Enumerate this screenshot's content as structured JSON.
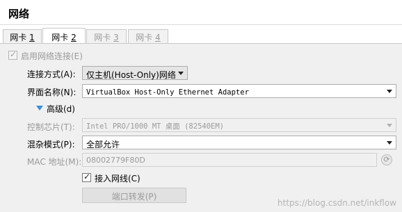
{
  "header": {
    "title": "网络"
  },
  "tabs": [
    {
      "label": "网卡 ",
      "key": "1",
      "state": "normal"
    },
    {
      "label": "网卡 ",
      "key": "2",
      "state": "active"
    },
    {
      "label": "网卡 ",
      "key": "3",
      "state": "disabled"
    },
    {
      "label": "网卡 ",
      "key": "4",
      "state": "disabled"
    }
  ],
  "enable_adapter": {
    "label": "启用网络连接(E)",
    "checked": true,
    "disabled": true
  },
  "attached_to": {
    "label": "连接方式(A):",
    "value": "仅主机(Host-Only)网络"
  },
  "adapter_name": {
    "label": "界面名称(N):",
    "value": "VirtualBox Host-Only Ethernet Adapter"
  },
  "advanced": {
    "label": "高级(d)",
    "expanded_icon": "triangle-down-icon"
  },
  "adapter_type": {
    "label": "控制芯片(T):",
    "value": "Intel PRO/1000 MT 桌面 (82540EM)"
  },
  "promiscuous": {
    "label": "混杂模式(P):",
    "value": "全部允许"
  },
  "mac": {
    "label": "MAC 地址(M):",
    "value": "08002779F80D",
    "refresh_icon": "refresh-icon"
  },
  "cable": {
    "label": "接入网线(C)",
    "checked": true
  },
  "port_forwarding": {
    "label": "端口转发(P)"
  },
  "watermark": "https://blog.csdn.net/inkflow",
  "colors": {
    "accent": "#3a8fd8",
    "panel_bg": "#f0f0f0",
    "disabled_text": "#9a9a9a"
  }
}
